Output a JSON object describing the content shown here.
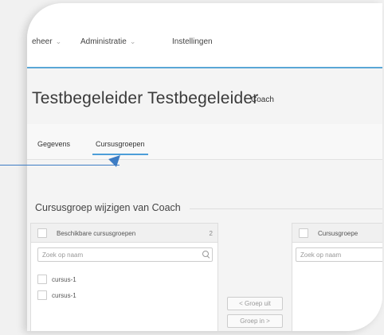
{
  "nav": {
    "items": [
      {
        "label": "eheer",
        "caret": true
      },
      {
        "label": "Administratie",
        "caret": true
      },
      {
        "label": "Instellingen",
        "caret": false
      }
    ]
  },
  "page": {
    "title": "Testbegeleider Testbegeleider",
    "role": "Coach"
  },
  "tabs": [
    {
      "label": "Gegevens"
    },
    {
      "label": "Cursusgroepen"
    }
  ],
  "section": {
    "title": "Cursusgroep wijzigen van Coach"
  },
  "available": {
    "header": "Beschikbare cursusgroepen",
    "count": "2",
    "search_placeholder": "Zoek op naam",
    "items": [
      {
        "label": "cursus-1"
      },
      {
        "label": "cursus-1"
      }
    ]
  },
  "assigned": {
    "header": "Cursusgroepe",
    "search_placeholder": "Zoek op naam"
  },
  "buttons": {
    "remove": "< Groep uit",
    "add": "Groep in >"
  },
  "colors": {
    "accent": "#4d9ed9",
    "annotation": "#3d7cc4"
  }
}
